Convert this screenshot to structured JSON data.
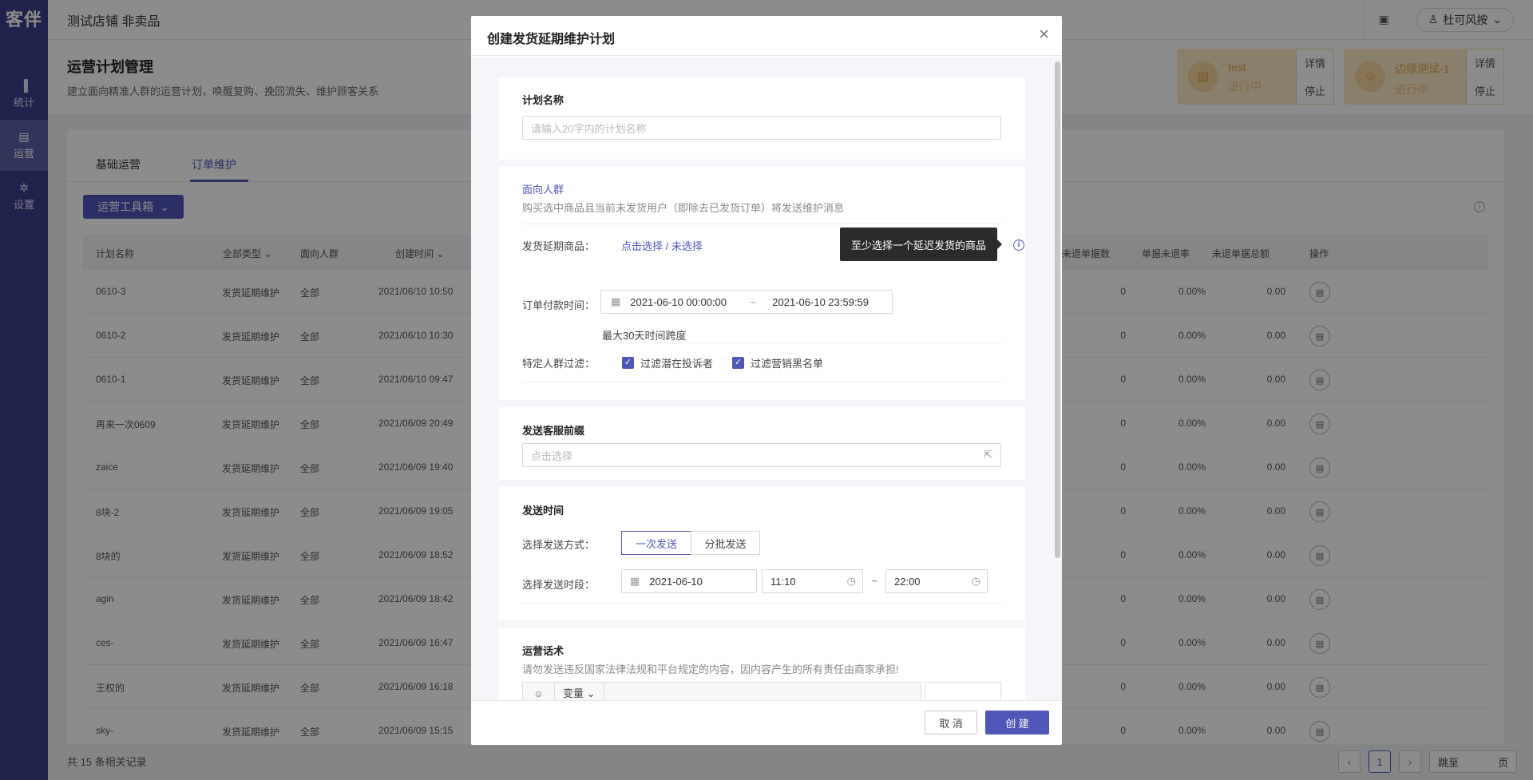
{
  "app": {
    "logo": "客伴",
    "shop_name": "测试店铺 非卖品"
  },
  "sidebar": {
    "items": [
      {
        "label": "统计",
        "icon": "bar-chart-icon"
      },
      {
        "label": "运营",
        "icon": "operation-icon"
      },
      {
        "label": "设置",
        "icon": "gear-icon"
      }
    ]
  },
  "topbar": {
    "user": "杜可风按"
  },
  "page": {
    "title": "运营计划管理",
    "subtitle": "建立面向精准人群的运营计划，唤醒复购、挽回流失、维护顾客关系",
    "plan_cards": [
      {
        "name": "test",
        "status": "进行中",
        "detail": "详情",
        "stop": "停止"
      },
      {
        "name": "边缘测试-1",
        "status": "进行中",
        "detail": "详情",
        "stop": "停止"
      }
    ]
  },
  "tabs": [
    "基础运营",
    "订单维护"
  ],
  "toolbox_label": "运营工具箱",
  "table": {
    "headers": [
      "计划名称",
      "全部类型",
      "面向人群",
      "创建时间",
      "未退单据数",
      "单据未退率",
      "未退单据总额",
      "操作"
    ],
    "rows": [
      {
        "name": "0610-3",
        "type": "发货延期维护",
        "audience": "全部",
        "created": "2021/06/10 10:50",
        "count": "0",
        "rate": "0.00%",
        "amount": "0.00"
      },
      {
        "name": "0610-2",
        "type": "发货延期维护",
        "audience": "全部",
        "created": "2021/06/10 10:30",
        "count": "0",
        "rate": "0.00%",
        "amount": "0.00"
      },
      {
        "name": "0610-1",
        "type": "发货延期维护",
        "audience": "全部",
        "created": "2021/06/10 09:47",
        "count": "0",
        "rate": "0.00%",
        "amount": "0.00"
      },
      {
        "name": "再来一次0609",
        "type": "发货延期维护",
        "audience": "全部",
        "created": "2021/06/09 20:49",
        "count": "0",
        "rate": "0.00%",
        "amount": "0.00"
      },
      {
        "name": "zaice",
        "type": "发货延期维护",
        "audience": "全部",
        "created": "2021/06/09 19:40",
        "count": "0",
        "rate": "0.00%",
        "amount": "0.00"
      },
      {
        "name": "8块-2",
        "type": "发货延期维护",
        "audience": "全部",
        "created": "2021/06/09 19:05",
        "count": "0",
        "rate": "0.00%",
        "amount": "0.00"
      },
      {
        "name": "8块的",
        "type": "发货延期维护",
        "audience": "全部",
        "created": "2021/06/09 18:52",
        "count": "0",
        "rate": "0.00%",
        "amount": "0.00"
      },
      {
        "name": "agin",
        "type": "发货延期维护",
        "audience": "全部",
        "created": "2021/06/09 18:42",
        "count": "0",
        "rate": "0.00%",
        "amount": "0.00"
      },
      {
        "name": "ces-",
        "type": "发货延期维护",
        "audience": "全部",
        "created": "2021/06/09 16:47",
        "count": "0",
        "rate": "0.00%",
        "amount": "0.00"
      },
      {
        "name": "王权的",
        "type": "发货延期维护",
        "audience": "全部",
        "created": "2021/06/09 16:18",
        "count": "0",
        "rate": "0.00%",
        "amount": "0.00"
      },
      {
        "name": "sky-",
        "type": "发货延期维护",
        "audience": "全部",
        "created": "2021/06/09 15:15",
        "count": "0",
        "rate": "0.00%",
        "amount": "0.00"
      }
    ]
  },
  "footer": {
    "total": "共 15 条相关记录",
    "current_page": "1",
    "jump_label": "跳至",
    "page_unit": "页"
  },
  "modal": {
    "title": "创建发货延期维护计划",
    "plan_name": {
      "label": "计划名称",
      "placeholder": "请输入20字内的计划名称"
    },
    "audience": {
      "title": "面向人群",
      "desc": "购买选中商品且当前未发货用户（即除去已发货订单）将发送维护消息",
      "product_label": "发货延期商品：",
      "product_link": "点击选择 / 未选择",
      "tooltip": "至少选择一个延迟发货的商品",
      "pay_time_label": "订单付款时间：",
      "start": "2021-06-10 00:00:00",
      "sep": "~",
      "end": "2021-06-10 23:59:59",
      "hint": "最大30天时间跨度",
      "filter_label": "特定人群过滤：",
      "filter1": "过滤潜在投诉者",
      "filter2": "过滤营销黑名单"
    },
    "prefix": {
      "title": "发送客服前缀",
      "placeholder": "点击选择"
    },
    "send_time": {
      "title": "发送时间",
      "mode_label": "选择发送方式：",
      "mode_once": "一次发送",
      "mode_batch": "分批发送",
      "period_label": "选择发送时段：",
      "date": "2021-06-10",
      "from": "11:10",
      "sep": "~",
      "to": "22:00"
    },
    "script": {
      "title": "运营话术",
      "desc": "请勿发送违反国家法律法规和平台规定的内容，因内容产生的所有责任由商家承担!",
      "variable_label": "变量"
    },
    "cancel": "取 消",
    "create": "创 建"
  },
  "colors": {
    "primary": "#4f57b8",
    "sidebar": "#3b3f8f",
    "card_bg": "#fbe7c4",
    "card_text": "#e2a044"
  }
}
